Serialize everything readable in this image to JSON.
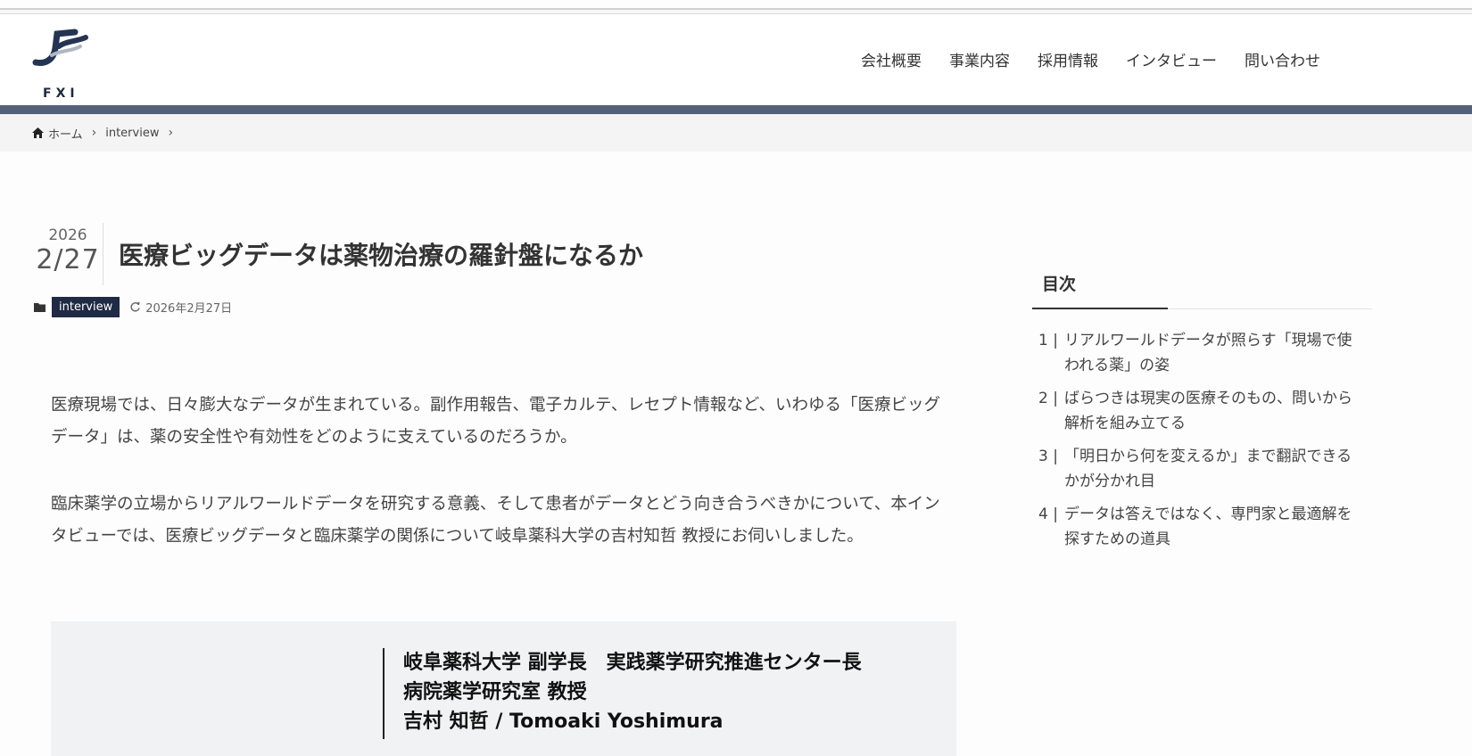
{
  "brand": {
    "logo_text": "FXI"
  },
  "nav": [
    {
      "label": "会社概要"
    },
    {
      "label": "事業内容"
    },
    {
      "label": "採用情報"
    },
    {
      "label": "インタビュー"
    },
    {
      "label": "問い合わせ"
    }
  ],
  "breadcrumb": {
    "home": "ホーム",
    "category": "interview"
  },
  "post": {
    "year": "2026",
    "month_day": "2/27",
    "title": "医療ビッグデータは薬物治療の羅針盤になるか",
    "category": "interview",
    "updated": "2026年2月27日",
    "paragraphs": [
      "医療現場では、日々膨大なデータが生まれている。副作用報告、電子カルテ、レセプト情報など、いわゆる「医療ビッグデータ」は、薬の安全性や有効性をどのように支えているのだろうか。",
      "臨床薬学の立場からリアルワールドデータを研究する意義、そして患者がデータとどう向き合うべきかについて、本インタビューでは、医療ビッグデータと臨床薬学の関係について岐阜薬科大学の吉村知哲 教授にお伺いしました。"
    ]
  },
  "profile": {
    "line1": "岐阜薬科大学 副学長　実践薬学研究推進センター長",
    "line2": "病院薬学研究室 教授",
    "line3": "吉村 知哲 / Tomoaki Yoshimura"
  },
  "toc": {
    "title": "目次",
    "items": [
      {
        "num": "1 |",
        "text": "リアルワールドデータが照らす「現場で使われる薬」の姿"
      },
      {
        "num": "2 |",
        "text": "ばらつきは現実の医療そのもの、問いから解析を組み立てる"
      },
      {
        "num": "3 |",
        "text": "「明日から何を変えるか」まで翻訳できるかが分かれ目"
      },
      {
        "num": "4 |",
        "text": "データは答えではなく、専門家と最適解を探すための道具"
      }
    ]
  },
  "colors": {
    "accent_bar": "#54617b",
    "badge_bg": "#1f2a44"
  },
  "icons": {
    "home": "home-icon",
    "breadcrumb_sep": "chevron-right-icon",
    "category": "folder-icon",
    "updated": "refresh-icon"
  }
}
